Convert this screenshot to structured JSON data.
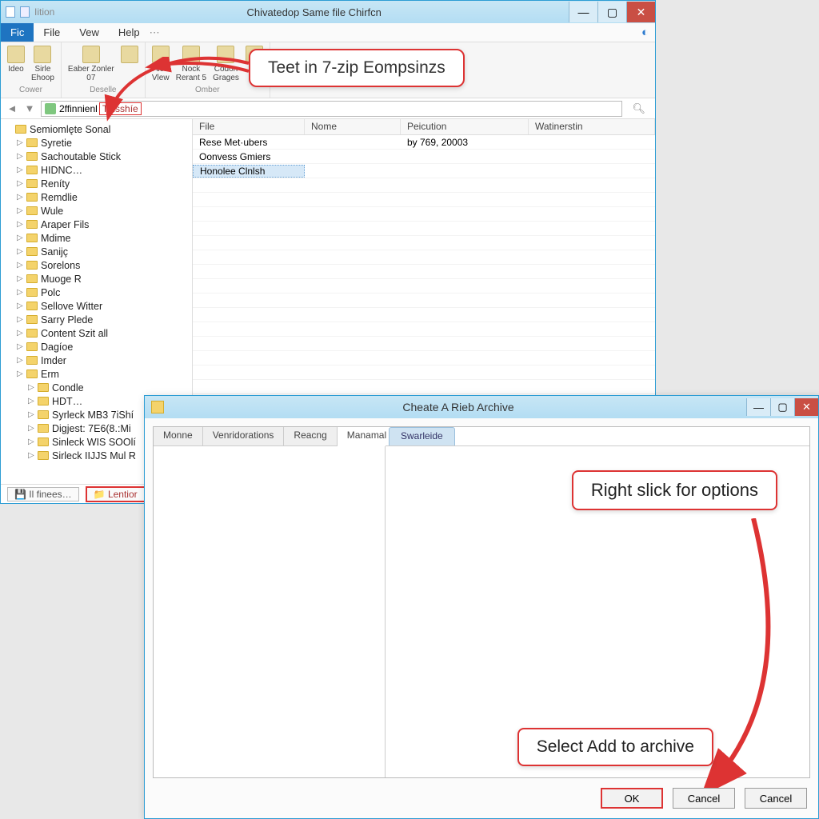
{
  "main_window": {
    "quick_icons": [
      "doc-icon",
      "page-icon"
    ],
    "quick_label": "Iition",
    "title": "Chivatedop Same file Chirfcn",
    "menubar": {
      "items": [
        "Fic",
        "File",
        "Vew",
        "Help"
      ],
      "active_index": 0
    },
    "ribbon": {
      "groups": [
        {
          "label": "Cower",
          "buttons": [
            {
              "l1": "Ideo",
              "l2": ""
            },
            {
              "l1": "Sirle",
              "l2": "Ehoop"
            }
          ]
        },
        {
          "label": "Deselle",
          "buttons": [
            {
              "l1": "Eaber Zonler",
              "l2": "07"
            },
            {
              "l1": "",
              "l2": ""
            }
          ]
        },
        {
          "label": "Omber",
          "buttons": [
            {
              "l1": "Alen",
              "l2": "Vlew"
            },
            {
              "l1": "Nock",
              "l2": "Rerant 5"
            },
            {
              "l1": "Codon",
              "l2": "Grages"
            },
            {
              "l1": "",
              "l2": ""
            }
          ]
        }
      ],
      "callout": "Teet in 7-zip Eompsinzs"
    },
    "address": {
      "prefix": "2ffinnienl",
      "hot": "Tinsshíe"
    },
    "tree": [
      {
        "d": 0,
        "t": "Semiomlęte Sonal"
      },
      {
        "d": 1,
        "t": "Syretie"
      },
      {
        "d": 1,
        "t": "Sachoutable Stick"
      },
      {
        "d": 1,
        "t": "HIDNC…"
      },
      {
        "d": 1,
        "t": "Reníty"
      },
      {
        "d": 1,
        "t": "Remdlie"
      },
      {
        "d": 1,
        "t": "Wule"
      },
      {
        "d": 1,
        "t": "Araper Fils"
      },
      {
        "d": 1,
        "t": "Mdime"
      },
      {
        "d": 1,
        "t": "Sanijç"
      },
      {
        "d": 1,
        "t": "Sorelons"
      },
      {
        "d": 1,
        "t": "Muoge R"
      },
      {
        "d": 1,
        "t": "Polc"
      },
      {
        "d": 1,
        "t": "Sellove Witter"
      },
      {
        "d": 1,
        "t": "Sarry Plede"
      },
      {
        "d": 1,
        "t": "Content Szit all"
      },
      {
        "d": 1,
        "t": "Dagíoe"
      },
      {
        "d": 1,
        "t": "Imder"
      },
      {
        "d": 1,
        "t": "Erm"
      },
      {
        "d": 2,
        "t": "Condle"
      },
      {
        "d": 2,
        "t": "HDT…"
      },
      {
        "d": 2,
        "t": "Syrleck MB3 7iShí"
      },
      {
        "d": 2,
        "t": "Digjest: 7E6(8.:Mi"
      },
      {
        "d": 2,
        "t": "Sinleck WIS SOOlí"
      },
      {
        "d": 2,
        "t": "Sirleck IIJJS Mul R"
      }
    ],
    "columns": [
      "File",
      "Nome",
      "Peicution",
      "Watinerstin"
    ],
    "rows": [
      {
        "c1": "Rese Met·ubers",
        "c2": "",
        "c3": "by 769, 20003",
        "c4": ""
      },
      {
        "c1": "Oonvess Gmiers",
        "c2": "",
        "c3": "",
        "c4": ""
      },
      {
        "c1": "Honolee Clnlsh",
        "c2": "",
        "c3": "",
        "c4": "",
        "selected": true
      }
    ],
    "status": {
      "left": "Il finees…",
      "hot": "Lentior"
    }
  },
  "dialog": {
    "title": "Cheate A Rieb Archive",
    "left_tabs": [
      "Monne",
      "Venridorations",
      "Reacng",
      "Manamal"
    ],
    "left_active": 3,
    "right_tab": "Swarleide",
    "callout_top": "Right slick for options",
    "callout_bottom": "Select Add to archive",
    "buttons": {
      "ok": "OK",
      "cancel1": "Cancel",
      "cancel2": "Cancel"
    }
  }
}
